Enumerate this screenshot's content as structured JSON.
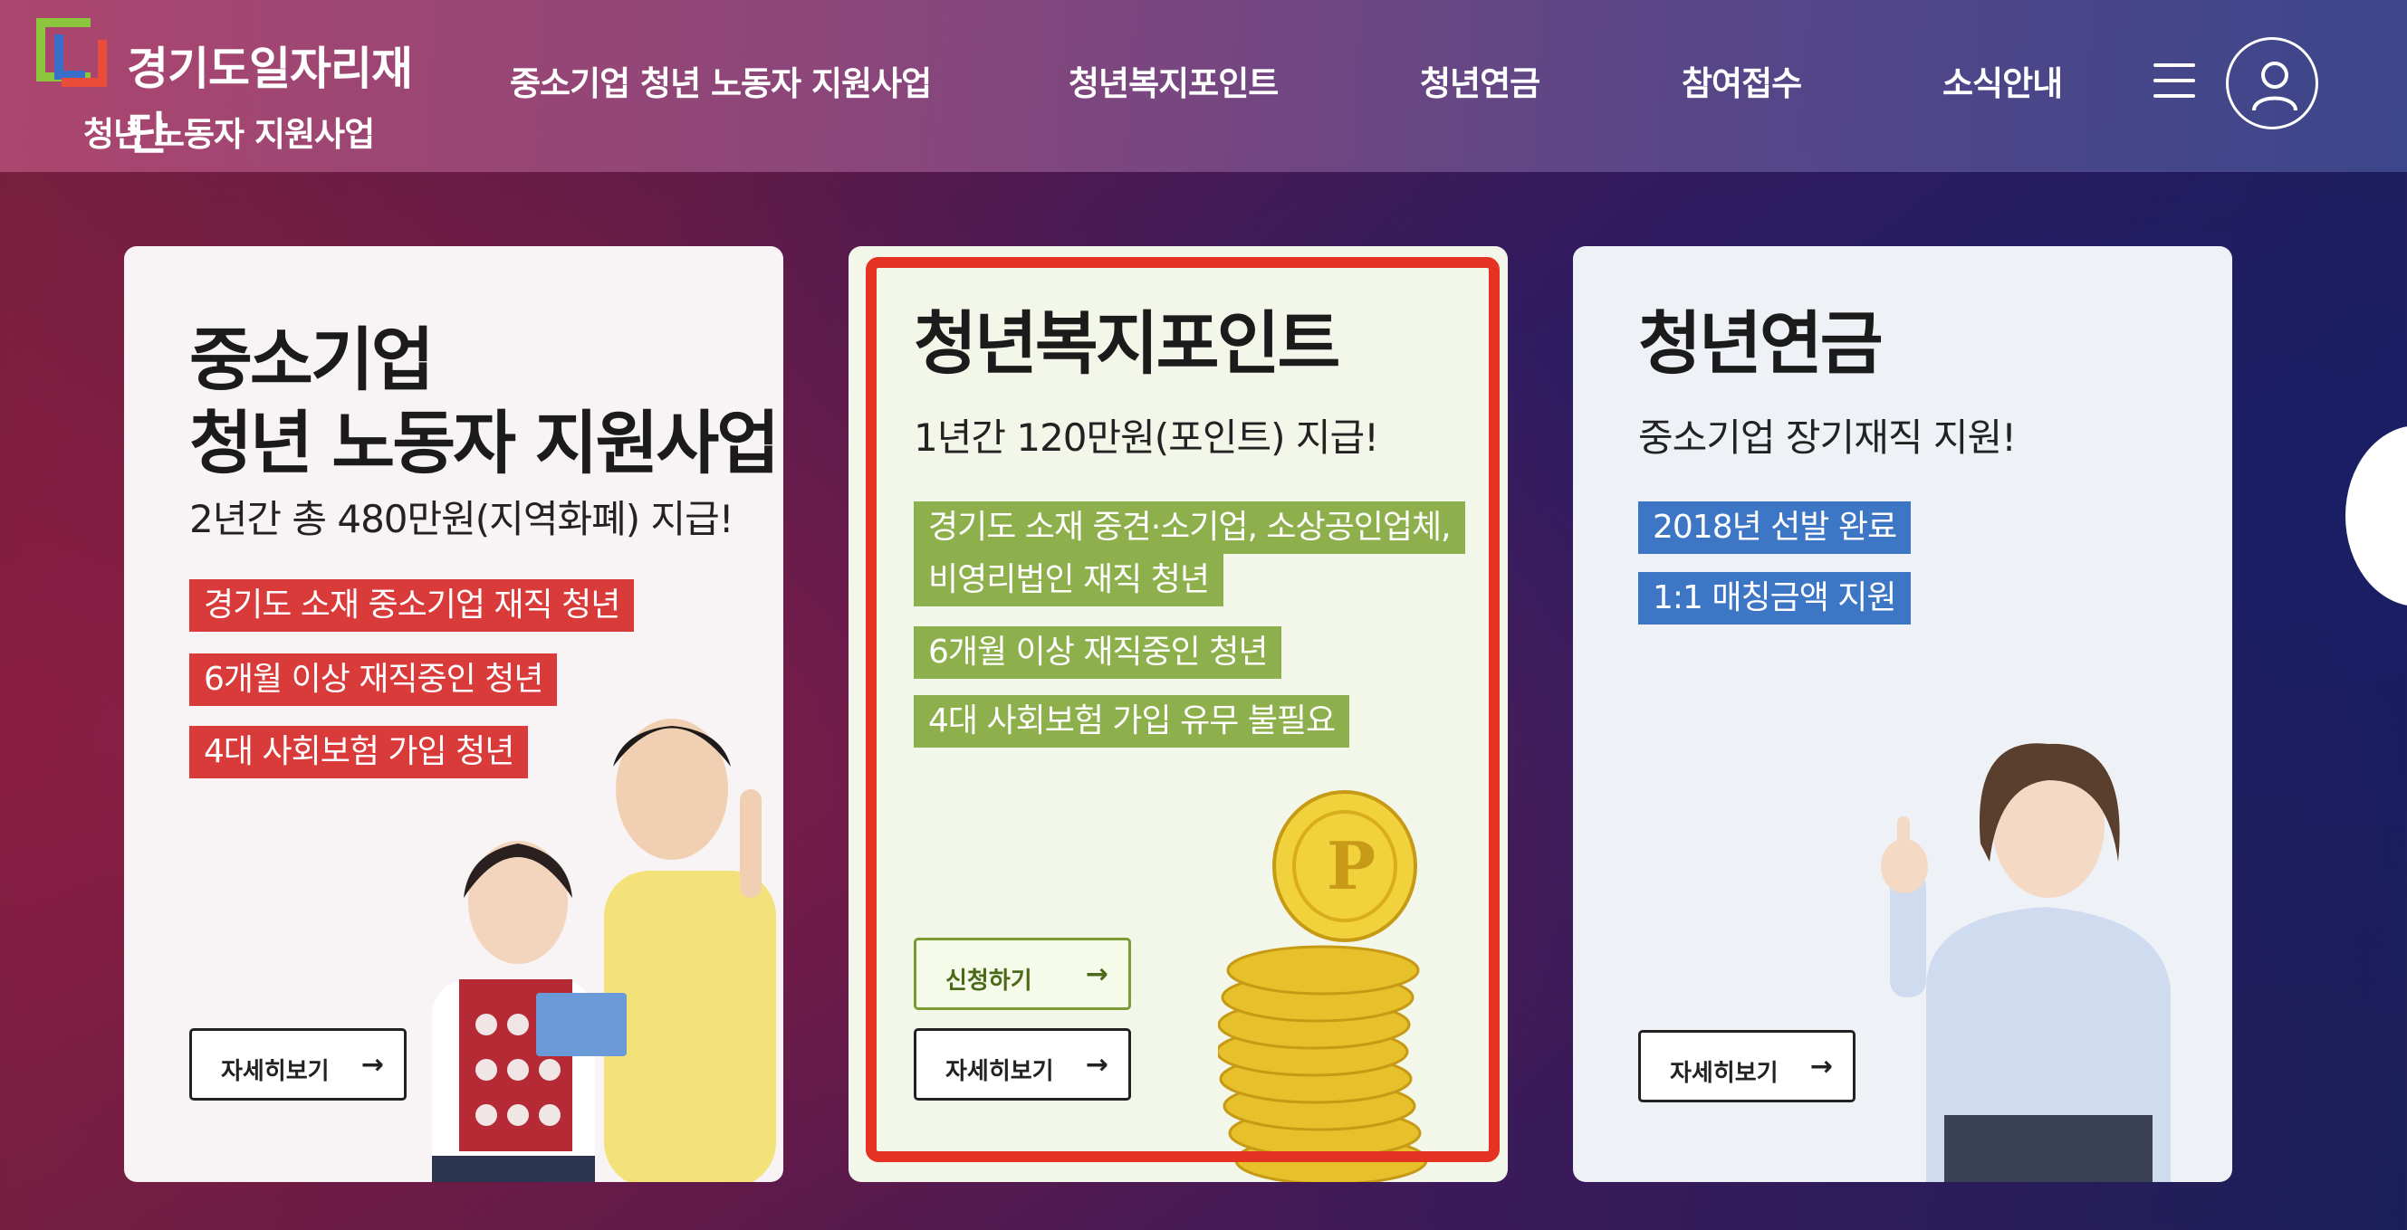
{
  "header": {
    "logo_name": "경기도일자리재단",
    "logo_sub": "청년 노동자 지원사업",
    "nav": [
      "중소기업 청년 노동자 지원사업",
      "청년복지포인트",
      "청년연금",
      "참여접수",
      "소식안내"
    ]
  },
  "cards": [
    {
      "title_line1": "중소기업",
      "title_line2": "청년 노동자 지원사업",
      "subtitle": "2년간 총 480만원(지역화폐) 지급!",
      "tags": [
        "경기도 소재 중소기업 재직 청년",
        "6개월 이상 재직중인 청년",
        "4대 사회보험 가입 청년"
      ],
      "detail_button": "자세히보기"
    },
    {
      "title_line1": "청년복지포인트",
      "subtitle": "1년간 120만원(포인트) 지급!",
      "tags": [
        "경기도 소재  중견·소기업, 소상공인업체,",
        "비영리법인 재직 청년",
        "6개월 이상 재직중인 청년",
        "4대 사회보험 가입 유무 불필요"
      ],
      "apply_button": "신청하기",
      "detail_button": "자세히보기"
    },
    {
      "title_line1": "청년연금",
      "subtitle": "중소기업 장기재직 지원!",
      "tags": [
        "2018년 선발 완료",
        "1:1 매칭금액 지원"
      ],
      "detail_button": "자세히보기"
    }
  ],
  "icons": {
    "menu": "hamburger-menu-icon",
    "user": "user-icon",
    "arrow": "→"
  },
  "colors": {
    "tag_red": "#d93a3a",
    "tag_green": "#8db04c",
    "tag_blue": "#3c76c4",
    "highlight": "#e43322"
  }
}
